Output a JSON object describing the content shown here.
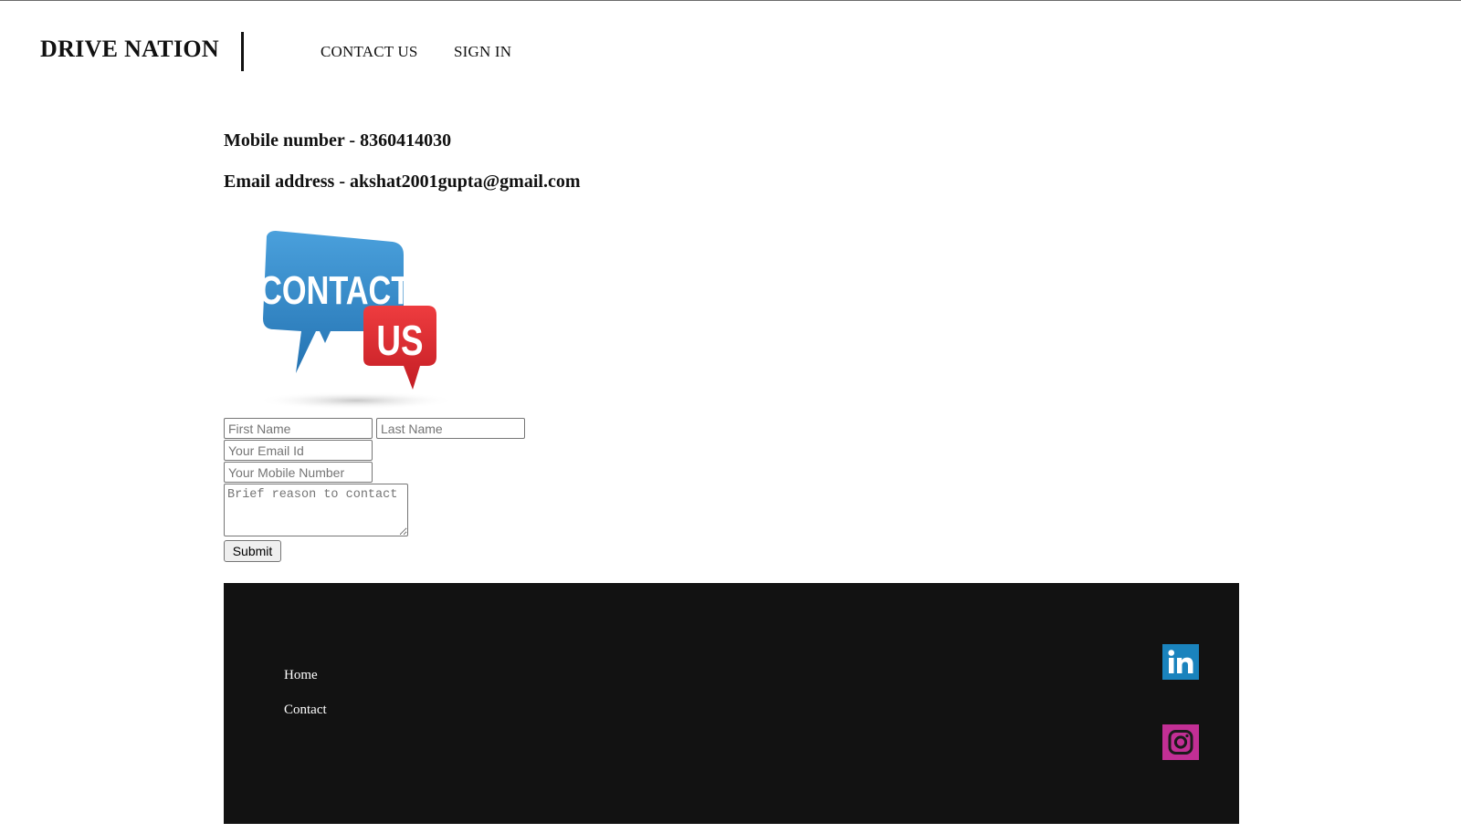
{
  "header": {
    "brand": "DRIVE NATION",
    "nav": {
      "contact_us": "CONTACT US",
      "sign_in": "SIGN IN"
    }
  },
  "contact_info": {
    "mobile": "Mobile number - 8360414030",
    "email": "Email address - akshat2001gupta@gmail.com"
  },
  "illustration": {
    "word1": "CONTACT",
    "word2": "US",
    "colors": {
      "blue": "#2f84c3",
      "red": "#d8262d"
    }
  },
  "form": {
    "first_name": {
      "placeholder": "First Name",
      "value": ""
    },
    "last_name": {
      "placeholder": "Last Name",
      "value": ""
    },
    "email": {
      "placeholder": "Your Email Id",
      "value": ""
    },
    "mobile": {
      "placeholder": "Your Mobile Number",
      "value": ""
    },
    "reason": {
      "placeholder": "Brief reason to contact",
      "value": ""
    },
    "submit_label": "Submit"
  },
  "footer": {
    "links": {
      "home": "Home",
      "contact": "Contact"
    },
    "social": [
      {
        "icon": "linkedin-icon",
        "color": "#1a83bd"
      },
      {
        "icon": "instagram-icon",
        "color": "#c22f95"
      }
    ],
    "background": "#121212"
  }
}
